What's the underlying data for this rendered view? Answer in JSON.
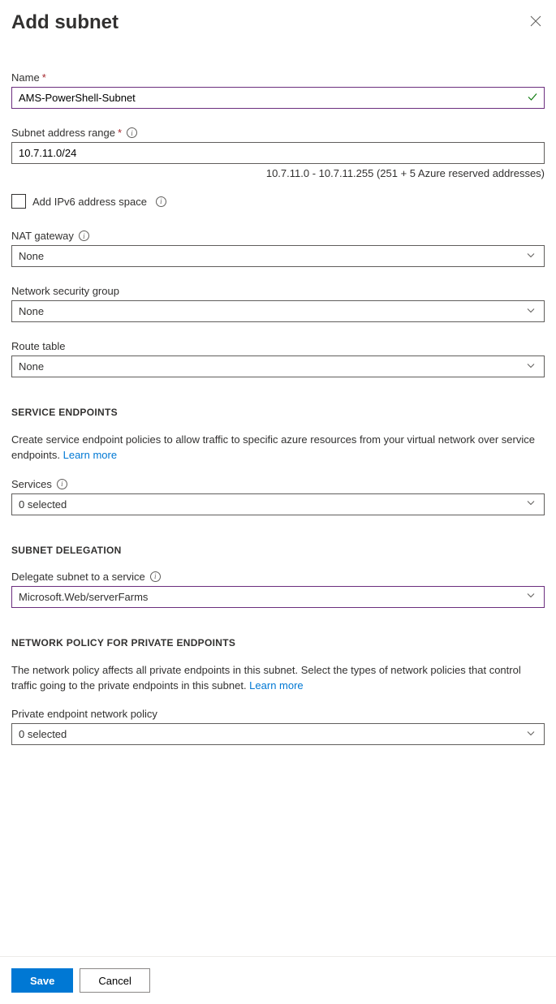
{
  "header": {
    "title": "Add subnet"
  },
  "name": {
    "label": "Name",
    "value": "AMS-PowerShell-Subnet"
  },
  "addressRange": {
    "label": "Subnet address range",
    "value": "10.7.11.0/24",
    "hint": "10.7.11.0 - 10.7.11.255 (251 + 5 Azure reserved addresses)"
  },
  "ipv6": {
    "label": "Add IPv6 address space"
  },
  "natGateway": {
    "label": "NAT gateway",
    "value": "None"
  },
  "nsg": {
    "label": "Network security group",
    "value": "None"
  },
  "routeTable": {
    "label": "Route table",
    "value": "None"
  },
  "serviceEndpoints": {
    "header": "SERVICE ENDPOINTS",
    "desc": "Create service endpoint policies to allow traffic to specific azure resources from your virtual network over service endpoints. ",
    "learnMore": "Learn more",
    "servicesLabel": "Services",
    "servicesValue": "0 selected"
  },
  "subnetDelegation": {
    "header": "SUBNET DELEGATION",
    "label": "Delegate subnet to a service",
    "value": "Microsoft.Web/serverFarms"
  },
  "networkPolicy": {
    "header": "NETWORK POLICY FOR PRIVATE ENDPOINTS",
    "desc": "The network policy affects all private endpoints in this subnet. Select the types of network policies that control traffic going to the private endpoints in this subnet. ",
    "learnMore": "Learn more",
    "label": "Private endpoint network policy",
    "value": "0 selected"
  },
  "footer": {
    "save": "Save",
    "cancel": "Cancel"
  }
}
